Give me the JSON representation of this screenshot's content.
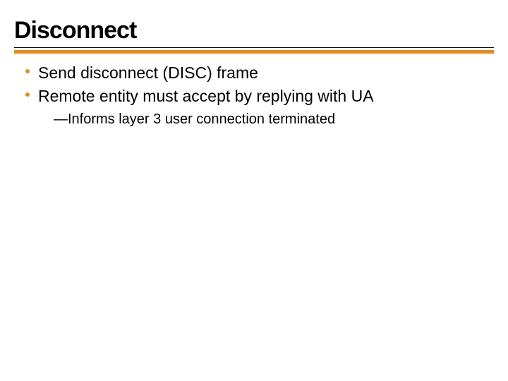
{
  "slide": {
    "title": "Disconnect",
    "bullets": [
      {
        "text": "Send disconnect (DISC) frame"
      },
      {
        "text": "Remote entity must accept by replying with UA",
        "sub": [
          {
            "dash": "—",
            "text": "Informs layer 3 user connection terminated"
          }
        ]
      }
    ],
    "colors": {
      "accent": "#e38b27"
    }
  }
}
